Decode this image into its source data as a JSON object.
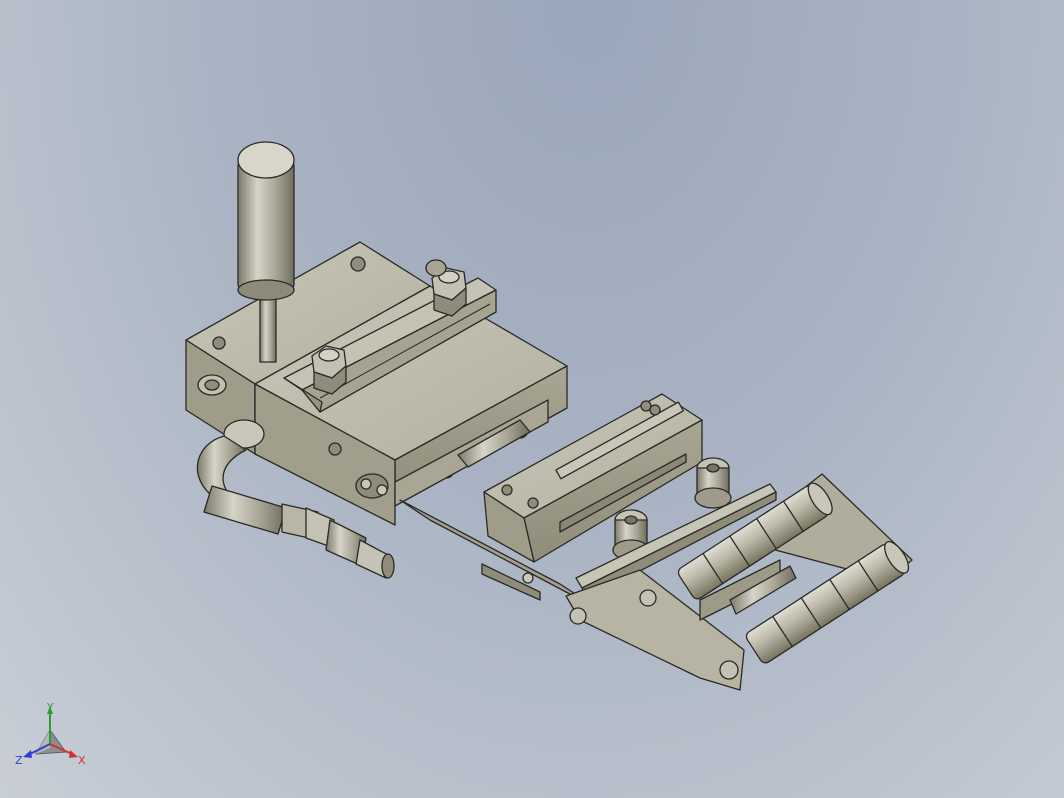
{
  "viewport": {
    "background_top": "#9aa6ba",
    "background_bottom": "#c9ced6",
    "part_color": "#b8b5a4",
    "part_shadow": "#8e8b7b",
    "edge_color": "#2a2a26"
  },
  "triad": {
    "x_label": "X",
    "y_label": "Y",
    "z_label": "Z",
    "x_color": "#d03030",
    "y_color": "#2f9a2f",
    "z_color": "#2f3fd0"
  }
}
